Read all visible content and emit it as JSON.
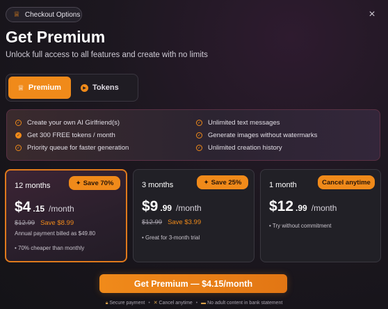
{
  "header": {
    "checkout_pill": "Checkout Options",
    "title": "Get Premium",
    "subtitle": "Unlock full access to all features and create with no limits",
    "close_glyph": "×"
  },
  "tabs": {
    "premium": "Premium",
    "tokens": "Tokens",
    "active": "premium"
  },
  "features": {
    "left": [
      "Create your own AI Girlfriend(s)",
      "Get 300 FREE tokens / month",
      "Priority queue for faster generation"
    ],
    "right": [
      "Unlimited text messages",
      "Generate images without watermarks",
      "Unlimited creation history"
    ]
  },
  "plans": [
    {
      "name": "12 months",
      "badge": "Save 70%",
      "price_main": "$4",
      "price_cents": ".15",
      "per": "/month",
      "old_price": "$12.99",
      "save_text": "Save $8.99",
      "billing": "Annual payment billed as $49.80",
      "note": "• 70% cheaper than monthly",
      "selected": true
    },
    {
      "name": "3 months",
      "badge": "Save 25%",
      "price_main": "$9",
      "price_cents": ".99",
      "per": "/month",
      "old_price": "$12.99",
      "save_text": "Save $3.99",
      "note": "• Great for 3-month trial",
      "selected": false
    },
    {
      "name": "1 month",
      "badge": "Cancel anytime",
      "price_main": "$12",
      "price_cents": ".99",
      "per": "/month",
      "note": "• Try without commitment",
      "selected": false
    }
  ],
  "cta": {
    "label": "Get Premium — $4.15/month"
  },
  "footer": {
    "secure": "Secure payment",
    "cancel": "Cancel anytime",
    "no_adult": "No adult content in bank statement"
  },
  "colors": {
    "accent": "#f08a1a",
    "background": "#141317",
    "card": "#212026",
    "selected_border": "#e07a1c"
  },
  "icons": {
    "checkout": "crown-icon",
    "premium_tab": "crown-icon",
    "tokens_tab": "coin-icon",
    "feature": "check-circle-icon",
    "badge": "sparkle-icon",
    "secure": "lock-icon",
    "cancel": "x-icon",
    "no_adult": "card-icon"
  }
}
